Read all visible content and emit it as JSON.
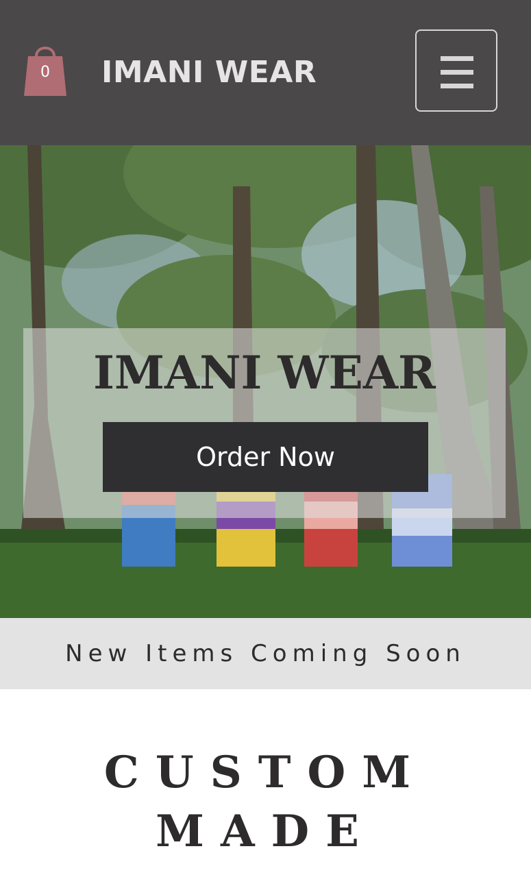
{
  "header": {
    "cart_count": "0",
    "brand": "IMANI WEAR",
    "cart_color": "#b06d74",
    "background": "#4a4849"
  },
  "hero": {
    "title": "IMANI WEAR",
    "cta_label": "Order Now"
  },
  "banner": {
    "text": "New Items Coming Soon"
  },
  "section": {
    "title": "CUSTOM MADE"
  }
}
